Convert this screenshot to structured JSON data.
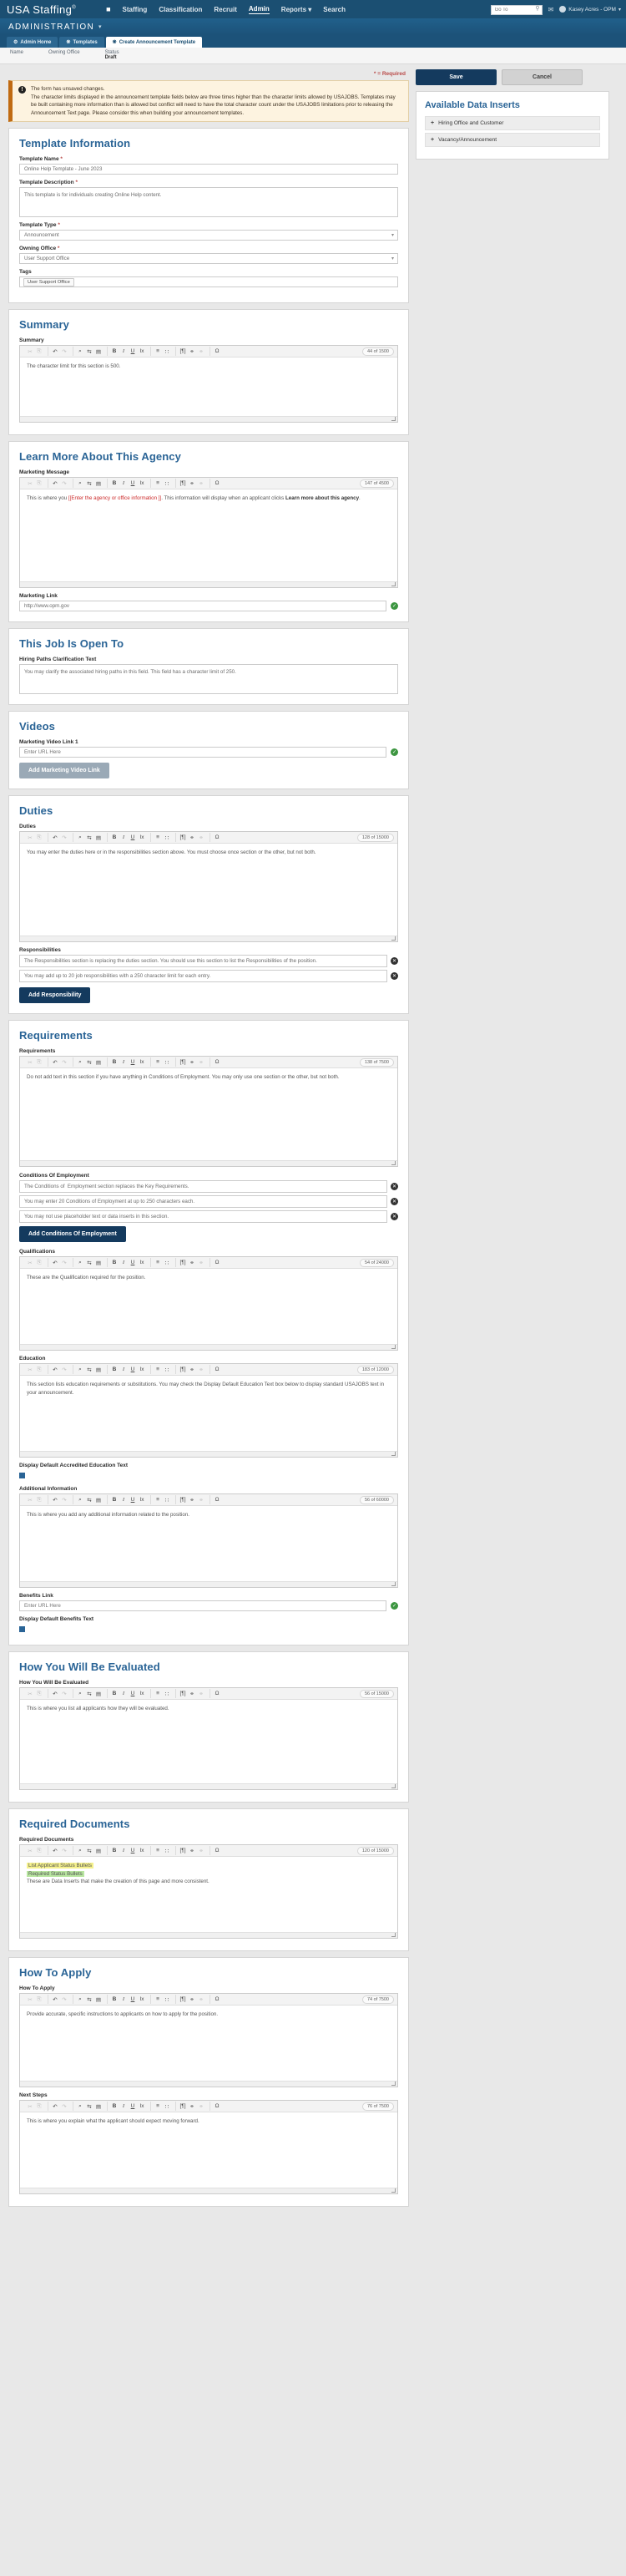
{
  "topbar": {
    "brand": "USA Staffing",
    "brand_sup": "®",
    "home_icon": "home-icon",
    "nav": [
      {
        "label": "Staffing",
        "active": false
      },
      {
        "label": "Classification",
        "active": false
      },
      {
        "label": "Recruit",
        "active": false
      },
      {
        "label": "Admin",
        "active": true
      },
      {
        "label": "Reports",
        "active": false,
        "caret": true
      },
      {
        "label": "Search",
        "active": false
      }
    ],
    "goto_placeholder": "Go To",
    "search_icon": "search-icon",
    "mail_icon": "mail-icon",
    "user_name": "Kasey Acres - OPM",
    "user_caret": "▾"
  },
  "adminbar": {
    "title": "ADMINISTRATION",
    "caret": "▾"
  },
  "tabs": [
    {
      "label": "Admin Home",
      "icon": "gear-icon",
      "active": false
    },
    {
      "label": "Templates",
      "icon": "templates-icon",
      "active": false
    },
    {
      "label": "Create Announcement Template",
      "icon": "templates-icon",
      "active": true
    }
  ],
  "record_header": [
    {
      "key": "Name",
      "value": ""
    },
    {
      "key": "Owning Office",
      "value": ""
    },
    {
      "key": "Status",
      "value": "Draft"
    }
  ],
  "actions": {
    "required_note": "* = Required",
    "save_label": "Save",
    "cancel_label": "Cancel"
  },
  "alert": {
    "icon": "exclamation-icon",
    "line1": "The form has unsaved changes.",
    "line2": "The character limits displayed in the announcement template fields below are three times higher than the character limits allowed by USAJOBS. Templates may be built containing more information than is allowed but conflict will need to have the total character count under the USAJOBS limitations prior to releasing the Announcement Text page. Please consider this when building your announcement templates."
  },
  "data_inserts": {
    "title": "Available Data Inserts",
    "items": [
      {
        "label": "Hiring Office and Customer",
        "plus": "+"
      },
      {
        "label": "Vacancy/Announcement",
        "plus": "+"
      }
    ]
  },
  "template_info": {
    "title": "Template Information",
    "name_label": "Template Name",
    "name_value": "Online Help Template - June 2023",
    "desc_label": "Template Description",
    "desc_value": "This template is for individuals creating Online Help content.",
    "type_label": "Template Type",
    "type_value": "Announcement",
    "office_label": "Owning Office",
    "office_value": "User Support Office",
    "tags_label": "Tags",
    "tag_value": "User Support Office",
    "asterisk": "*"
  },
  "summary": {
    "title": "Summary",
    "field_label": "Summary",
    "counter": "44 of 1500",
    "body": "The character limit for this section is 500."
  },
  "agency": {
    "title": "Learn More About This Agency",
    "msg_label": "Marketing Message",
    "counter": "147 of 4500",
    "body_pre": "This is where you ",
    "body_red": "[[Enter the agency or office information ]]",
    "body_mid": ". This information will display when an applicant clicks ",
    "body_bold": "Learn more about this agency",
    "body_end": ".",
    "link_label": "Marketing Link",
    "link_value": "http://www.opm.gov",
    "valid_icon": "check-circle-icon"
  },
  "open_to": {
    "title": "This Job Is Open To",
    "field_label": "Hiring Paths Clarification Text",
    "body": "You may clarify the associated hiring paths in this field. This field has a character limit of 250."
  },
  "videos": {
    "title": "Videos",
    "link_label": "Marketing Video Link 1",
    "link_placeholder": "Enter URL Here",
    "valid_icon": "check-circle-icon",
    "add_label": "Add Marketing Video Link"
  },
  "duties": {
    "title": "Duties",
    "field_label": "Duties",
    "counter": "128 of 15000",
    "body": "You may enter the duties here or in the responsibilities section above. You must choose once section or the other, but not both.",
    "resp_label": "Responsibilities",
    "resp_rows": [
      "The Responsibilities section is replacing the duties section. You should use this section to list the Responsibilities of the position.",
      "You may add up to 20 job responsibilities with a 250 character limit for each entry."
    ],
    "add_label": "Add Responsibility",
    "delete_icon": "delete-circle-icon"
  },
  "requirements": {
    "title": "Requirements",
    "req_label": "Requirements",
    "req_counter": "138 of 7500",
    "req_body": "Do not add text in this section if you have anything in Conditions of Employment. You may only use one section or the other, but not both.",
    "coe_label": "Conditions Of Employment",
    "coe_rows": [
      "The Conditions of  Employment section replaces the Key Requirements.",
      "You may enter 20 Conditions of Employment at up to 250 characters each.",
      "You may not use placeholder text or data inserts in this section."
    ],
    "coe_add_label": "Add Conditions Of Employment",
    "qual_label": "Qualifications",
    "qual_counter": "54 of 24000",
    "qual_body": "These are the Qualification required for the position.",
    "edu_label": "Education",
    "edu_counter": "183 of 12000",
    "edu_body": "This section lists education requirements or substitutions. You may check the Display Default Education Text box below to display standard USAJOBS text in your announcement.",
    "edu_default_label": "Display Default Accredited Education Text",
    "addl_label": "Additional Information",
    "addl_counter": "56 of 60000",
    "addl_body": "This is where you add any additional information related to the position.",
    "benefits_link_label": "Benefits Link",
    "benefits_link_placeholder": "Enter URL Here",
    "benefits_default_label": "Display Default Benefits Text",
    "delete_icon": "delete-circle-icon",
    "valid_icon": "check-circle-icon"
  },
  "evaluated": {
    "title": "How You Will Be Evaluated",
    "field_label": "How You Will Be Evaluated",
    "counter": "56 of 15000",
    "body": "This is where you list all applicants how they will be evaluated."
  },
  "documents": {
    "title": "Required Documents",
    "field_label": "Required Documents",
    "counter": "120 of 15000",
    "counter_alt": "120 of 15000",
    "hl1": "List Applicant Status Bullets",
    "hl2": "Required Status Bullets",
    "body": "These are Data Inserts that make the creation of this page and more consistent."
  },
  "apply": {
    "title": "How To Apply",
    "howto_label": "How To Apply",
    "howto_counter": "74 of 7500",
    "howto_body": "Provide accurate, specific instructions to applicants on how to apply for the position.",
    "next_label": "Next Steps",
    "next_counter": "76 of 7500",
    "next_body": "This is where you explain what the applicant should expect moving forward."
  },
  "toolbar": {
    "buttons": [
      {
        "name": "cut-icon",
        "glyph": "✂",
        "dim": true
      },
      {
        "name": "copy-icon",
        "glyph": "⎘",
        "dim": true
      },
      {
        "name": "undo-icon",
        "glyph": "↶",
        "dim": false
      },
      {
        "name": "redo-icon",
        "glyph": "↷",
        "dim": true
      },
      {
        "name": "find-icon",
        "glyph": "⌕",
        "dim": false
      },
      {
        "name": "replace-icon",
        "glyph": "⇆",
        "dim": false
      },
      {
        "name": "select-all-icon",
        "glyph": "▤",
        "dim": false
      },
      {
        "name": "bold-icon",
        "glyph": "B",
        "dim": false
      },
      {
        "name": "italic-icon",
        "glyph": "I",
        "dim": false
      },
      {
        "name": "underline-icon",
        "glyph": "U",
        "dim": false
      },
      {
        "name": "remove-format-icon",
        "glyph": "Ix",
        "dim": false
      },
      {
        "name": "numbered-list-icon",
        "glyph": "≡",
        "dim": false
      },
      {
        "name": "bulleted-list-icon",
        "glyph": "∷",
        "dim": false
      },
      {
        "name": "data-insert-icon",
        "glyph": "[¶]",
        "dim": false
      },
      {
        "name": "link-icon",
        "glyph": "⚭",
        "dim": false
      },
      {
        "name": "unlink-icon",
        "glyph": "⚭",
        "dim": true
      },
      {
        "name": "special-char-icon",
        "glyph": "Ω",
        "dim": false
      }
    ]
  }
}
